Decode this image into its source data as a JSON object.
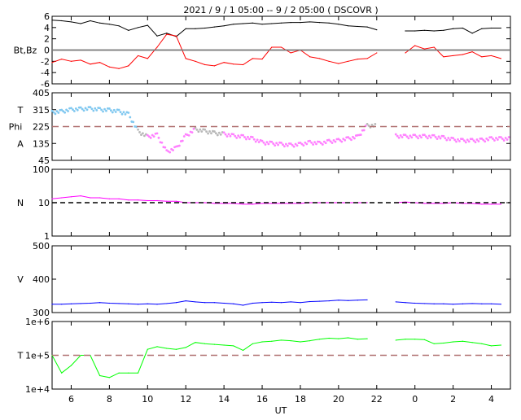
{
  "chart_data": {
    "type": "line",
    "title": "2021 /  9 /  1   05:00 --  9 /  2   05:00 ( DSCOVR )",
    "xlabel": "UT",
    "xlim_hours": [
      5,
      29
    ],
    "x_ticks": [
      {
        "h": 6,
        "label": "6"
      },
      {
        "h": 8,
        "label": "8"
      },
      {
        "h": 10,
        "label": "10"
      },
      {
        "h": 12,
        "label": "12"
      },
      {
        "h": 14,
        "label": "14"
      },
      {
        "h": 16,
        "label": "16"
      },
      {
        "h": 18,
        "label": "18"
      },
      {
        "h": 20,
        "label": "20"
      },
      {
        "h": 22,
        "label": "22"
      },
      {
        "h": 24,
        "label": "0"
      },
      {
        "h": 26,
        "label": "2"
      },
      {
        "h": 28,
        "label": "4"
      }
    ],
    "sample_start_hour": 5,
    "sample_step_hours": 0.5,
    "panels": [
      {
        "id": "mag",
        "ylabel": "Bt,Bz",
        "scale": "linear",
        "ylim": [
          -6,
          6
        ],
        "y_ticks": [
          {
            "v": 6,
            "label": "6"
          },
          {
            "v": 4,
            "label": "4"
          },
          {
            "v": 2,
            "label": "2"
          },
          {
            "v": 0,
            "label": "0"
          },
          {
            "v": -2,
            "label": "-2"
          },
          {
            "v": -4,
            "label": "-4"
          },
          {
            "v": -6,
            "label": "-6"
          }
        ],
        "reference": {
          "value": 0,
          "color": "#777777",
          "dashed": false
        },
        "series": [
          {
            "name": "Bt",
            "color": "#000000",
            "values": [
              5.3,
              5.2,
              5.0,
              4.7,
              5.2,
              4.8,
              4.6,
              4.3,
              3.5,
              4.0,
              4.4,
              2.5,
              3.0,
              2.4,
              3.8,
              3.8,
              3.9,
              4.1,
              4.3,
              4.6,
              4.7,
              4.8,
              4.6,
              4.7,
              4.8,
              4.9,
              4.9,
              5.0,
              4.9,
              4.8,
              4.6,
              4.3,
              4.2,
              4.1,
              3.6,
              null,
              null,
              3.4,
              3.4,
              3.5,
              3.4,
              3.5,
              3.8,
              3.9,
              3.0,
              3.8,
              3.9,
              3.9,
              null
            ]
          },
          {
            "name": "Bz",
            "color": "#ff0000",
            "values": [
              -2.2,
              -1.6,
              -2.0,
              -1.8,
              -2.5,
              -2.2,
              -3.0,
              -3.3,
              -2.8,
              -1.0,
              -1.5,
              0.5,
              2.8,
              2.5,
              -1.5,
              -2.0,
              -2.6,
              -2.8,
              -2.2,
              -2.5,
              -2.6,
              -1.5,
              -1.6,
              0.5,
              0.5,
              -0.5,
              0.0,
              -1.2,
              -1.5,
              -2.0,
              -2.4,
              -2.0,
              -1.6,
              -1.5,
              -0.5,
              null,
              null,
              -0.5,
              0.8,
              0.2,
              0.5,
              -1.2,
              -1.0,
              -0.8,
              -0.3,
              -1.2,
              -1.0,
              -1.5,
              null
            ]
          }
        ]
      },
      {
        "id": "phi",
        "ylabel_lines": [
          "T",
          "Phi",
          "A"
        ],
        "scale": "linear",
        "ylim": [
          45,
          405
        ],
        "y_ticks": [
          {
            "v": 405,
            "label": "405"
          },
          {
            "v": 315,
            "label": "315"
          },
          {
            "v": 225,
            "label": "225"
          },
          {
            "v": 135,
            "label": "135"
          },
          {
            "v": 45,
            "label": "45"
          }
        ],
        "reference": {
          "value": 225,
          "color": "#b07070",
          "dashed": true
        },
        "point_colors": {
          "toward": "#80c8f0",
          "transition": "#b8b8b8",
          "away": "#ff80ff"
        },
        "series": [
          {
            "name": "Phi",
            "style": "points",
            "values": [
              300,
              305,
              315,
              318,
              320,
              315,
              312,
              305,
              290,
              200,
              170,
              180,
              90,
              110,
              175,
              210,
              200,
              190,
              185,
              175,
              170,
              160,
              140,
              135,
              130,
              125,
              130,
              140,
              135,
              145,
              150,
              160,
              170,
              230,
              null,
              null,
              175,
              172,
              172,
              172,
              170,
              165,
              155,
              150,
              150,
              152,
              160,
              160,
              null
            ]
          }
        ]
      },
      {
        "id": "density",
        "ylabel": "N",
        "scale": "log",
        "ylim": [
          1,
          100
        ],
        "y_ticks": [
          {
            "v": 100,
            "label": "100"
          },
          {
            "v": 10,
            "label": "10"
          },
          {
            "v": 1,
            "label": "1"
          }
        ],
        "reference": {
          "value": 10,
          "color": "#000000",
          "dashed": true
        },
        "series": [
          {
            "name": "N",
            "color": "#ff00ff",
            "values": [
              13,
              14,
              15,
              16,
              14,
              14,
              13,
              13,
              12,
              12,
              11.5,
              11.5,
              11,
              11,
              10,
              10,
              10,
              9.5,
              9.5,
              9.5,
              9,
              9,
              9.5,
              9.5,
              9.5,
              9.5,
              9.5,
              10,
              10,
              10,
              10,
              10,
              10,
              10,
              null,
              null,
              10,
              10.5,
              10,
              9.5,
              9.5,
              9.5,
              10,
              9.5,
              9.5,
              9,
              9,
              9,
              null
            ]
          }
        ]
      },
      {
        "id": "speed",
        "ylabel": "V",
        "scale": "linear",
        "ylim": [
          300,
          500
        ],
        "y_ticks": [
          {
            "v": 500,
            "label": "500"
          },
          {
            "v": 400,
            "label": "400"
          },
          {
            "v": 300,
            "label": "300"
          }
        ],
        "series": [
          {
            "name": "V",
            "color": "#0000ff",
            "values": [
              325,
              325,
              326,
              327,
              328,
              330,
              328,
              327,
              326,
              325,
              326,
              325,
              327,
              330,
              335,
              332,
              330,
              330,
              328,
              326,
              322,
              328,
              330,
              331,
              330,
              332,
              330,
              333,
              334,
              335,
              337,
              336,
              337,
              338,
              null,
              null,
              332,
              330,
              328,
              327,
              326,
              326,
              325,
              326,
              327,
              326,
              326,
              325,
              null
            ]
          }
        ]
      },
      {
        "id": "temperature",
        "ylabel": "T",
        "scale": "log",
        "ylim": [
          10000,
          1000000
        ],
        "y_ticks": [
          {
            "v": 1000000,
            "label": "1e+6"
          },
          {
            "v": 100000,
            "label": "1e+5"
          },
          {
            "v": 10000,
            "label": "1e+4"
          }
        ],
        "reference": {
          "value": 100000,
          "color": "#b07070",
          "dashed": true
        },
        "series": [
          {
            "name": "T",
            "color": "#00ff00",
            "values": [
              100000,
              30000,
              50000,
              100000,
              100000,
              25000,
              22000,
              30000,
              30000,
              30000,
              150000,
              180000,
              160000,
              150000,
              170000,
              240000,
              220000,
              210000,
              200000,
              190000,
              140000,
              220000,
              250000,
              260000,
              280000,
              270000,
              250000,
              270000,
              300000,
              320000,
              310000,
              330000,
              300000,
              310000,
              null,
              null,
              280000,
              300000,
              300000,
              290000,
              220000,
              230000,
              250000,
              260000,
              240000,
              220000,
              190000,
              200000,
              null
            ]
          }
        ]
      }
    ]
  }
}
